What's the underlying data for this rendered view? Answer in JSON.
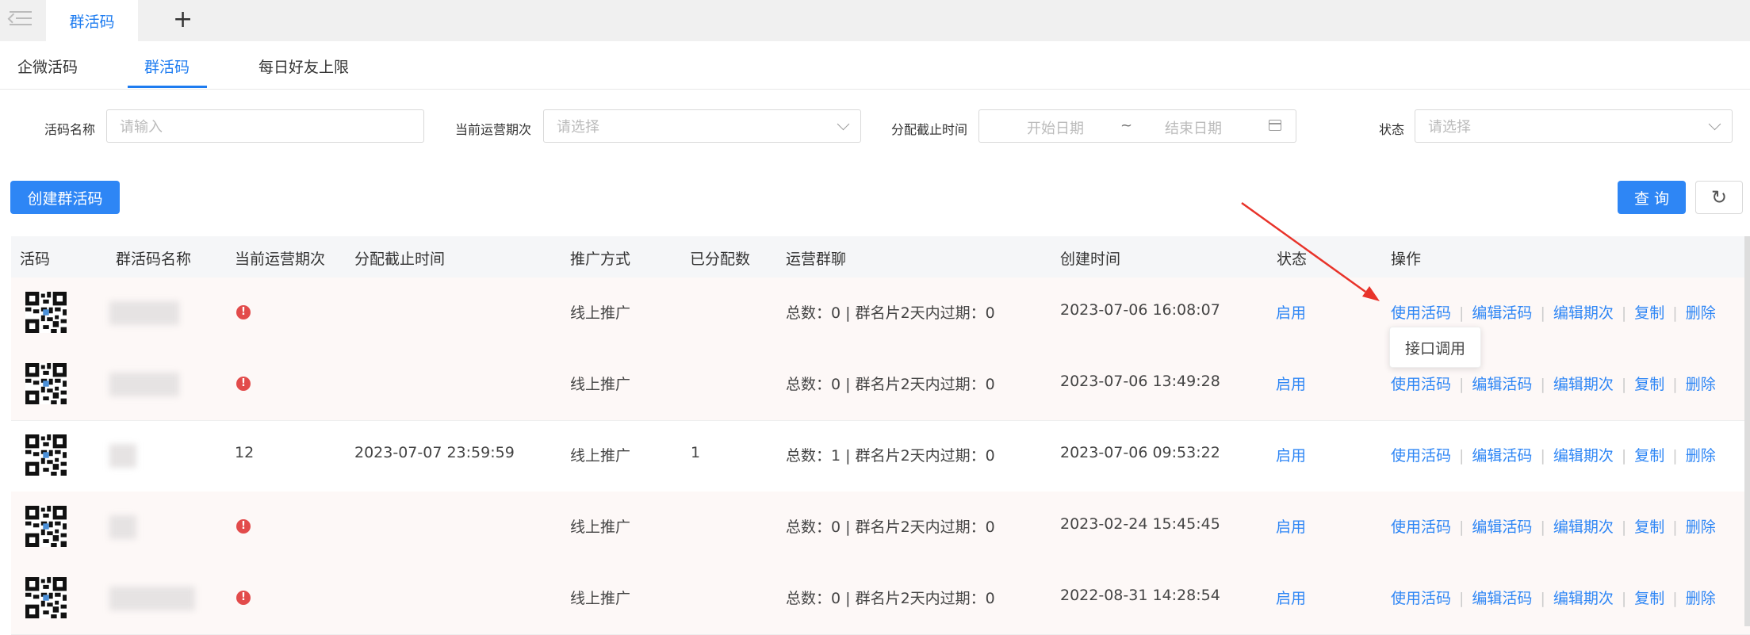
{
  "tabbar": {
    "active_tab": "群活码",
    "add_label": "+"
  },
  "subtabs": [
    {
      "label": "企微活码",
      "active": false
    },
    {
      "label": "群活码",
      "active": true
    },
    {
      "label": "每日好友上限",
      "active": false
    }
  ],
  "filters": {
    "name_label": "活码名称",
    "name_placeholder": "请输入",
    "period_label": "当前运营期次",
    "period_placeholder": "请选择",
    "deadline_label": "分配截止时间",
    "start_placeholder": "开始日期",
    "range_sep": "~",
    "end_placeholder": "结束日期",
    "status_label": "状态",
    "status_placeholder": "请选择"
  },
  "actions": {
    "create_label": "创建群活码",
    "query_label": "查 询",
    "refresh_icon": "↻"
  },
  "table": {
    "columns": [
      "活码",
      "群活码名称",
      "当前运营期次",
      "分配截止时间",
      "推广方式",
      "已分配数",
      "运营群聊",
      "创建时间",
      "状态",
      "操作"
    ],
    "rows": [
      {
        "period": "",
        "deadline": "",
        "promo": "线上推广",
        "assigned": "",
        "groups": "总数：0 | 群名片2天内过期：0",
        "created": "2023-07-06 16:08:07",
        "status": "启用"
      },
      {
        "period": "",
        "deadline": "",
        "promo": "线上推广",
        "assigned": "",
        "groups": "总数：0 | 群名片2天内过期：0",
        "created": "2023-07-06 13:49:28",
        "status": "启用"
      },
      {
        "period": "12",
        "deadline": "2023-07-07 23:59:59",
        "promo": "线上推广",
        "assigned": "1",
        "groups": "总数：1 | 群名片2天内过期：0",
        "created": "2023-07-06 09:53:22",
        "status": "启用"
      },
      {
        "period": "",
        "deadline": "",
        "promo": "线上推广",
        "assigned": "",
        "groups": "总数：0 | 群名片2天内过期：0",
        "created": "2023-02-24 15:45:45",
        "status": "启用"
      },
      {
        "period": "",
        "deadline": "",
        "promo": "线上推广",
        "assigned": "",
        "groups": "总数：0 | 群名片2天内过期：0",
        "created": "2022-08-31 14:28:54",
        "status": "启用"
      }
    ],
    "ops": [
      "使用活码",
      "编辑活码",
      "编辑期次",
      "复制",
      "删除"
    ],
    "tooltip": "接口调用"
  },
  "colors": {
    "accent": "#2e86f5",
    "warning": "#e24b4b",
    "annotation": "#e8332a"
  }
}
